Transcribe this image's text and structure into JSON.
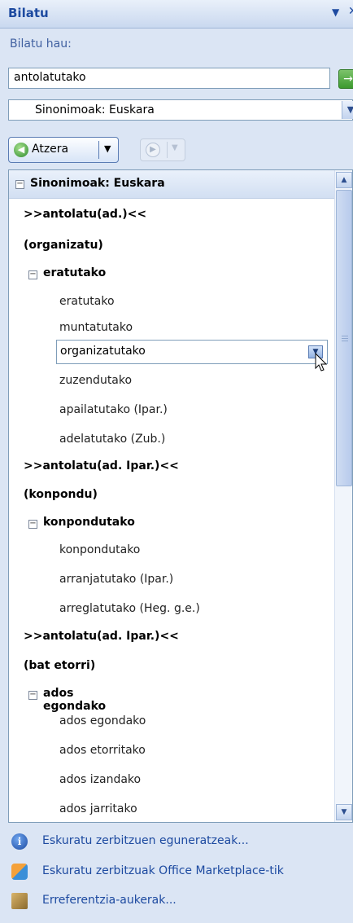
{
  "pane": {
    "title": "Bilatu"
  },
  "search": {
    "label": "Bilatu hau:",
    "value": "antolatutako",
    "source": "Sinonimoak: Euskara"
  },
  "nav": {
    "back_label": "Atzera"
  },
  "results": {
    "header": "Sinonimoak: Euskara",
    "headings": [
      ">>antolatu(ad.)<<",
      "(organizatu)",
      ">>antolatu(ad. Ipar.)<<",
      "(konpondu)",
      ">>antolatu(ad. Ipar.)<<",
      "(bat etorri)"
    ],
    "groups": [
      "eratutako",
      "konpondutako",
      "ados egondako"
    ],
    "selected": "organizatutako",
    "items": [
      "eratutako",
      "muntatutako",
      "zuzendutako",
      "apailatutako (Ipar.)",
      "adelatutako (Zub.)",
      "konpondutako",
      "arranjatutako (Ipar.)",
      "arreglatutako (Heg. g.e.)",
      "ados egondako",
      "ados etorritako",
      "ados izandako",
      "ados jarritako"
    ]
  },
  "links": [
    "Eskuratu zerbitzuen eguneratzeak...",
    "Eskuratu zerbitzuak Office Marketplace-tik",
    "Erreferentzia-aukerak..."
  ]
}
